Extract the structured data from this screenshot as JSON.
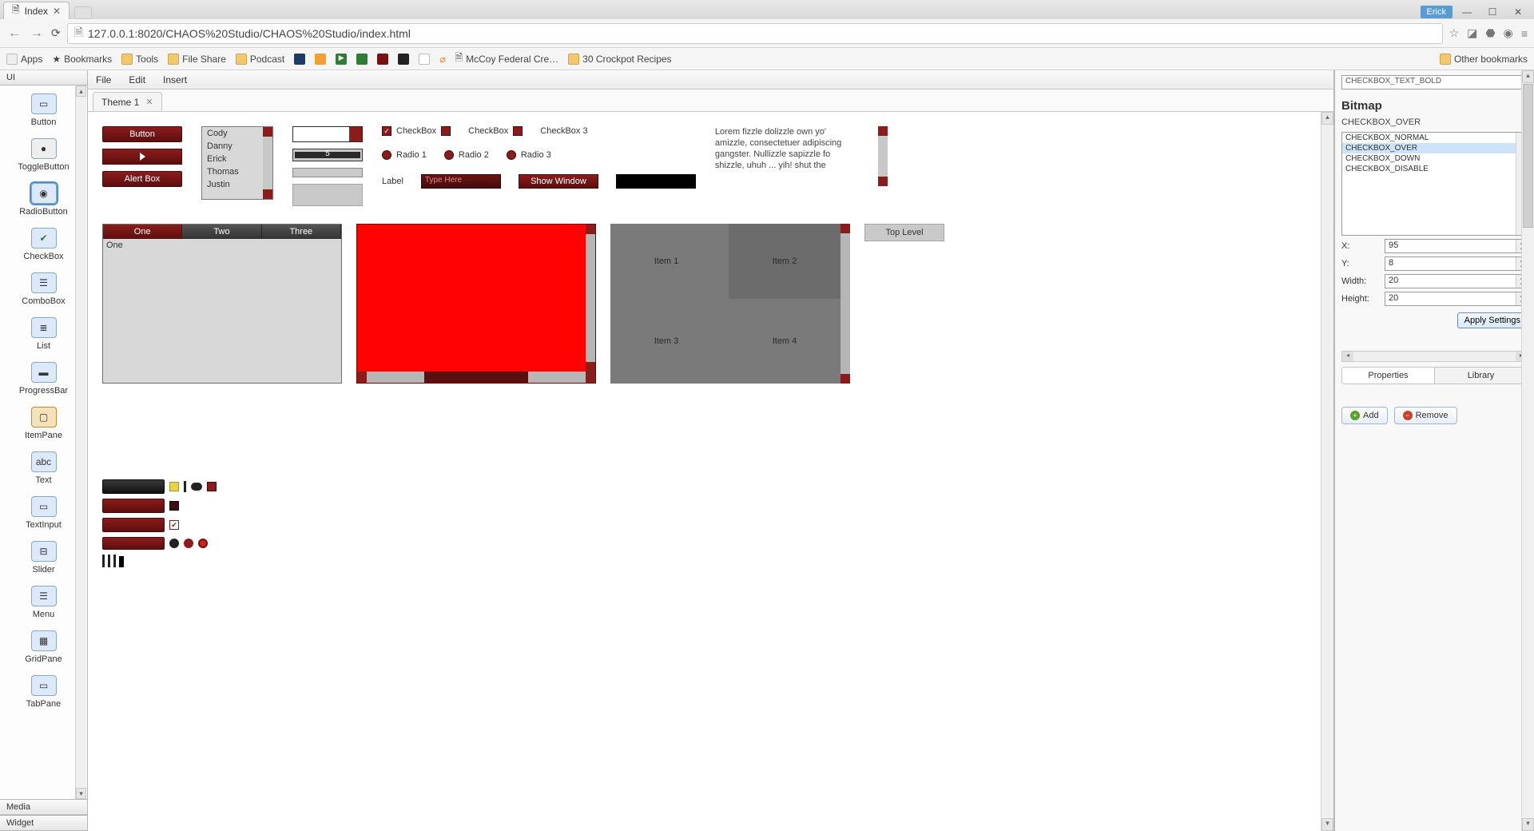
{
  "browser": {
    "tab_title": "Index",
    "user_badge": "Erick",
    "url": "127.0.0.1:8020/CHAOS%20Studio/CHAOS%20Studio/index.html"
  },
  "bookmarks": {
    "apps": "Apps",
    "bookmarks": "Bookmarks",
    "tools": "Tools",
    "fileshare": "File Share",
    "podcast": "Podcast",
    "mccoy": "McCoy Federal Cre…",
    "crockpot": "30 Crockpot Recipes",
    "other": "Other bookmarks"
  },
  "palette": {
    "header": "UI",
    "items": [
      "Button",
      "ToggleButton",
      "RadioButton",
      "CheckBox",
      "ComboBox",
      "List",
      "ProgressBar",
      "ItemPane",
      "Text",
      "TextInput",
      "Slider",
      "Menu",
      "GridPane",
      "TabPane"
    ],
    "footer": [
      "Media",
      "Widget"
    ]
  },
  "menu": {
    "file": "File",
    "edit": "Edit",
    "insert": "Insert"
  },
  "doc_tab": "Theme 1",
  "canvas": {
    "btn_button": "Button",
    "btn_alert": "Alert Box",
    "list": [
      "Cody",
      "Danny",
      "Erick",
      "Thomas",
      "Justin"
    ],
    "slider_value": "5",
    "checkbox1": "CheckBox",
    "checkbox2": "CheckBox",
    "checkbox3": "CheckBox 3",
    "radio1": "Radio 1",
    "radio2": "Radio 2",
    "radio3": "Radio 3",
    "label": "Label",
    "type_here": "Type Here",
    "show_window": "Show Window",
    "lorem": "Lorem fizzle dolizzle own yo' amizzle, consectetuer adipiscing gangster. Nullizzle sapizzle fo shizzle, uhuh ... yih! shut the",
    "tabs": [
      "One",
      "Two",
      "Three"
    ],
    "tab_content": "One",
    "grid_items": [
      "Item 1",
      "Item 2",
      "Item 3",
      "Item 4"
    ],
    "top_level": "Top Level"
  },
  "props": {
    "dropdown_preview": "CHECKBOX_TEXT_BOLD",
    "section": "Bitmap",
    "current": "CHECKBOX_OVER",
    "states": [
      "CHECKBOX_NORMAL",
      "CHECKBOX_OVER",
      "CHECKBOX_DOWN",
      "CHECKBOX_DISABLE"
    ],
    "x_label": "X:",
    "x": "95",
    "y_label": "Y:",
    "y": "8",
    "w_label": "Width:",
    "w": "20",
    "h_label": "Height:",
    "h": "20",
    "apply": "Apply Settings",
    "tab_props": "Properties",
    "tab_lib": "Library",
    "add": "Add",
    "remove": "Remove"
  }
}
